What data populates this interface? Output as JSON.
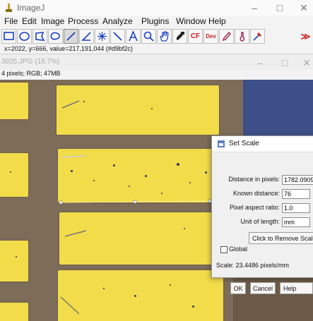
{
  "main_window": {
    "title": "ImageJ",
    "minimize": "–",
    "maximize": "□",
    "close": "✕",
    "menu": [
      "File",
      "Edit",
      "Image",
      "Process",
      "Analyze",
      "Plugins",
      "Window",
      "Help"
    ],
    "tools": [
      "rectangle-tool",
      "oval-tool",
      "polygon-tool",
      "freehand-tool",
      "straight-line-tool",
      "angle-tool",
      "multipoint-tool",
      "wand-tool",
      "text-tool",
      "magnifier-tool",
      "hand-tool",
      "dropper-tool",
      "cf-tool",
      "dev-tool",
      "pencil-tool",
      "brush-tool",
      "color-picker-tool",
      "more-tools"
    ],
    "cf_label": "CF",
    "dev_label": "Dev",
    "more_label": "≫",
    "status": "x=2022, y=666, value=217,191,044 (#d9bf2c)"
  },
  "image_window": {
    "title": "3925.JPG (16.7%)",
    "minimize": "–",
    "maximize": "□",
    "close": "✕",
    "info": "4 pixels; RGB; 47MB"
  },
  "dialog": {
    "title": "Set Scale",
    "distance_label": "Distance in pixels:",
    "distance_value": "1782.0909",
    "known_label": "Known distance:",
    "known_value": "76",
    "aspect_label": "Pixel aspect ratio:",
    "aspect_value": "1.0",
    "unit_label": "Unit of length:",
    "unit_value": "mm",
    "remove_button": "Click to Remove Scale",
    "global_label": "Global",
    "scale_text": "Scale: 23.4486 pixels/mm",
    "ok": "OK",
    "cancel": "Cancel",
    "help": "Help"
  },
  "colors": {
    "strip_yellow": "#f2dc4a",
    "board_brown": "#7d6c58",
    "toolbar_red": "#cc2222",
    "tool_blue": "#1a3fbf"
  }
}
